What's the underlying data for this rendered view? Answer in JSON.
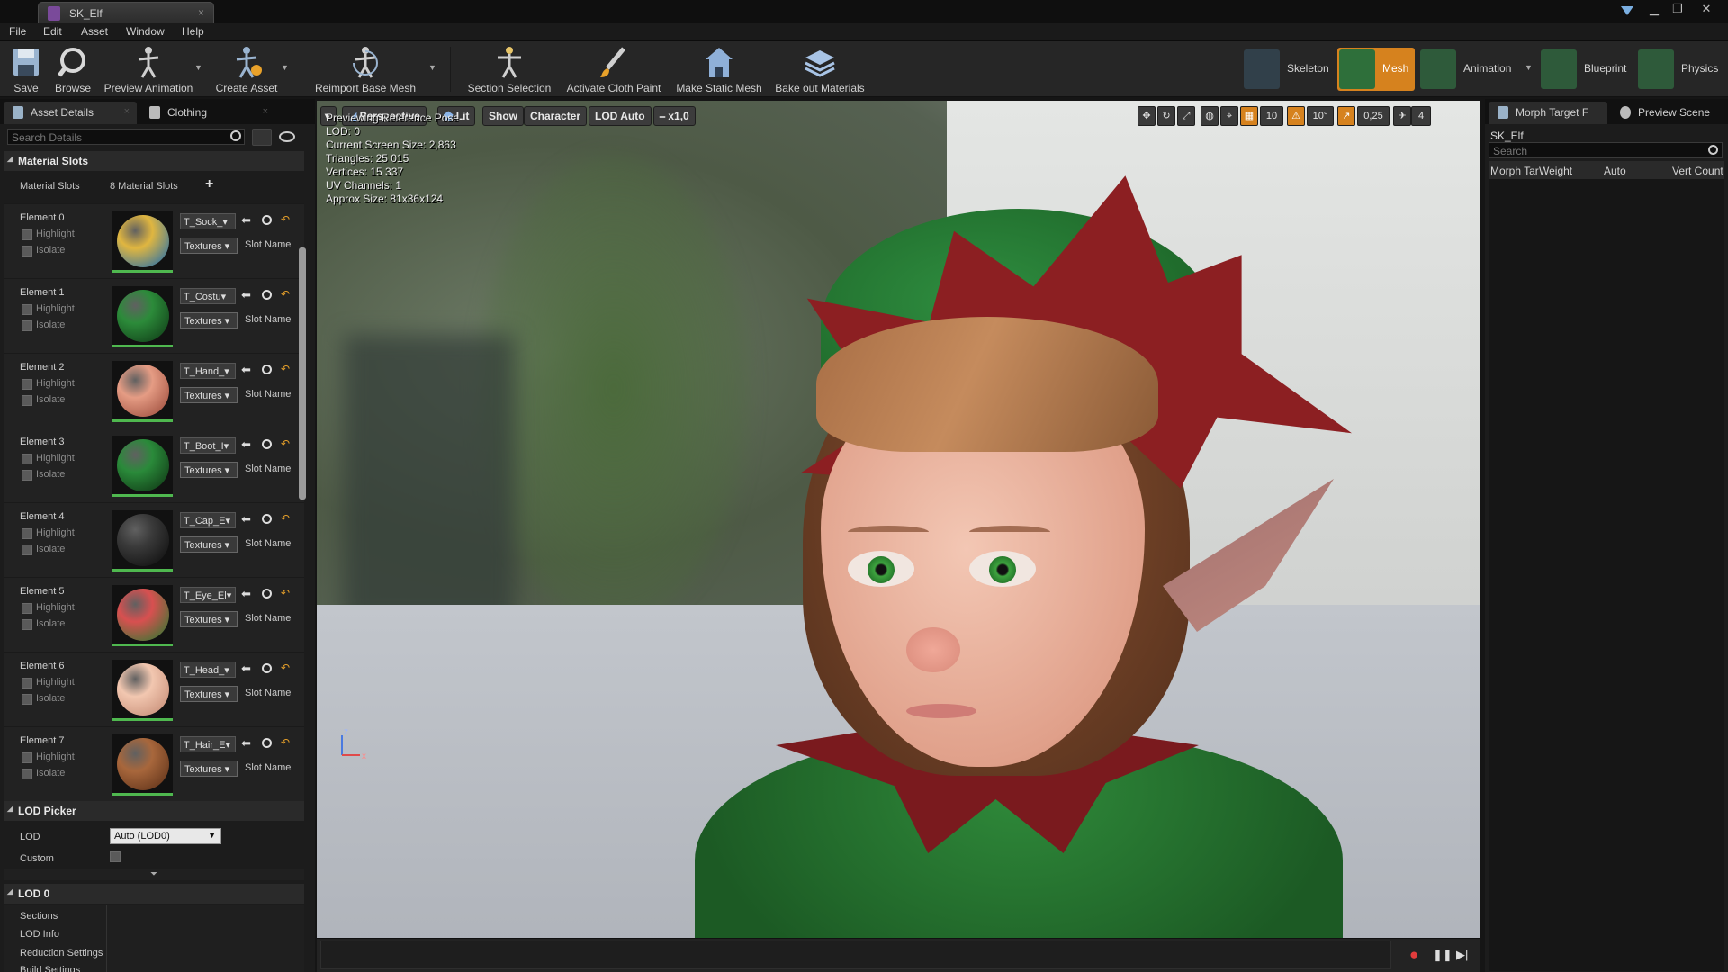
{
  "window": {
    "tab_title": "SK_Elf",
    "tab_close": "×",
    "controls": {
      "minimize": "▁",
      "restore": "❐",
      "close": "✕"
    }
  },
  "menu": [
    "File",
    "Edit",
    "Asset",
    "Window",
    "Help"
  ],
  "toolbar": {
    "save": "Save",
    "browse": "Browse",
    "preview_animation": "Preview Animation",
    "create_asset": "Create Asset",
    "reimport": "Reimport Base Mesh",
    "section_selection": "Section Selection",
    "activate_cloth_paint": "Activate Cloth Paint",
    "make_static_mesh": "Make Static Mesh",
    "bake_out_materials": "Bake out Materials",
    "modes": {
      "skeleton": "Skeleton",
      "mesh": "Mesh",
      "animation": "Animation",
      "blueprint": "Blueprint",
      "physics": "Physics"
    },
    "dropdown_glyph": "▼"
  },
  "left_panel": {
    "tabs": {
      "asset_details": "Asset Details",
      "clothing": "Clothing",
      "close": "×"
    },
    "search_placeholder": "Search Details",
    "material_slots": {
      "header": "Material Slots",
      "label": "Material Slots",
      "count": "8 Material Slots",
      "add": "+",
      "highlight": "Highlight",
      "isolate": "Isolate",
      "textures": "Textures ▾",
      "slot_name": "Slot Name",
      "elements": [
        {
          "title": "Element 0",
          "texture": "T_Sock_▾",
          "colors": [
            "#e0b640",
            "#1c6bb0"
          ]
        },
        {
          "title": "Element 1",
          "texture": "T_Costu▾",
          "colors": [
            "#2c8b3a",
            "#0f3a16"
          ]
        },
        {
          "title": "Element 2",
          "texture": "T_Hand_▾",
          "colors": [
            "#e59c84",
            "#9a4a3a"
          ]
        },
        {
          "title": "Element 3",
          "texture": "T_Boot_I▾",
          "colors": [
            "#2a8a3a",
            "#0f3514"
          ]
        },
        {
          "title": "Element 4",
          "texture": "T_Cap_E▾",
          "colors": [
            "#3a3a3a",
            "#0d0d0d"
          ]
        },
        {
          "title": "Element 5",
          "texture": "T_Eye_El▾",
          "colors": [
            "#d85050",
            "#2a7a30"
          ]
        },
        {
          "title": "Element 6",
          "texture": "T_Head_▾",
          "colors": [
            "#f2c7b0",
            "#c48a74"
          ]
        },
        {
          "title": "Element 7",
          "texture": "T_Hair_E▾",
          "colors": [
            "#a8673c",
            "#5c3018"
          ]
        }
      ]
    },
    "lod_picker": {
      "header": "LOD Picker",
      "lod_label": "LOD",
      "lod_value": "Auto (LOD0)",
      "custom_label": "Custom",
      "expand": "⏷"
    },
    "lod0": {
      "header": "LOD 0",
      "items": [
        "Sections",
        "LOD Info",
        "Reduction Settings",
        "Build Settings"
      ]
    }
  },
  "viewport": {
    "buttons": {
      "menu": "▾",
      "perspective": "Perspective",
      "lit": "Lit",
      "show": "Show",
      "character": "Character",
      "lod_auto": "LOD Auto",
      "speed": "x1,0"
    },
    "snap": {
      "grid": "10",
      "angle": "10°",
      "scale": "0,25",
      "camera_speed": "4"
    },
    "info": [
      "Previewing Reference Pose",
      "LOD: 0",
      "Current Screen Size: 2,863",
      "Triangles: 25 015",
      "Vertices: 15 337",
      "UV Channels: 1",
      "Approx Size: 81x36x124"
    ],
    "axis": {
      "z": "z",
      "x": "x"
    },
    "timeline": {
      "record": "●",
      "pause": "❚❚",
      "play": "▶|"
    }
  },
  "right_panel": {
    "tabs": {
      "morph": "Morph Target F",
      "preview_scene": "Preview Scene"
    },
    "title": "SK_Elf",
    "search_placeholder": "Search",
    "columns": {
      "morph_target": "Morph Tar",
      "weight": "Weight",
      "auto": "Auto",
      "vert_count": "Vert Count"
    }
  }
}
